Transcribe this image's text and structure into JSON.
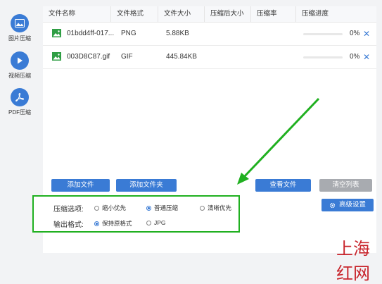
{
  "sidebar": {
    "items": [
      {
        "label": "图片压缩",
        "icon": "image-icon"
      },
      {
        "label": "视频压缩",
        "icon": "play-icon"
      },
      {
        "label": "PDF压缩",
        "icon": "pdf-icon"
      }
    ]
  },
  "table": {
    "columns": [
      "文件名称",
      "文件格式",
      "文件大小",
      "压缩后大小",
      "压缩率",
      "压缩进度"
    ],
    "rows": [
      {
        "name": "01bdd4ff-017...",
        "format": "PNG",
        "size": "5.88KB",
        "compressed": "",
        "ratio": "",
        "progress": 0,
        "progress_text": "0%"
      },
      {
        "name": "003D8C87.gif",
        "format": "GIF",
        "size": "445.84KB",
        "compressed": "",
        "ratio": "",
        "progress": 0,
        "progress_text": "0%"
      }
    ]
  },
  "buttons": {
    "add_file": "添加文件",
    "add_folder": "添加文件夹",
    "view_file": "查看文件",
    "clear_list": "清空列表",
    "advanced": "高级设置"
  },
  "options": {
    "compress_label": "压缩选项:",
    "compress_choices": [
      "缩小优先",
      "普通压缩",
      "清晰优先"
    ],
    "compress_selected": "普通压缩",
    "format_label": "输出格式:",
    "format_choices": [
      "保持原格式",
      "JPG"
    ],
    "format_selected": "保持原格式"
  },
  "watermark": "上海红网",
  "colors": {
    "accent": "#3a7bd5",
    "highlight": "#20b020",
    "watermark": "#c8242b"
  }
}
